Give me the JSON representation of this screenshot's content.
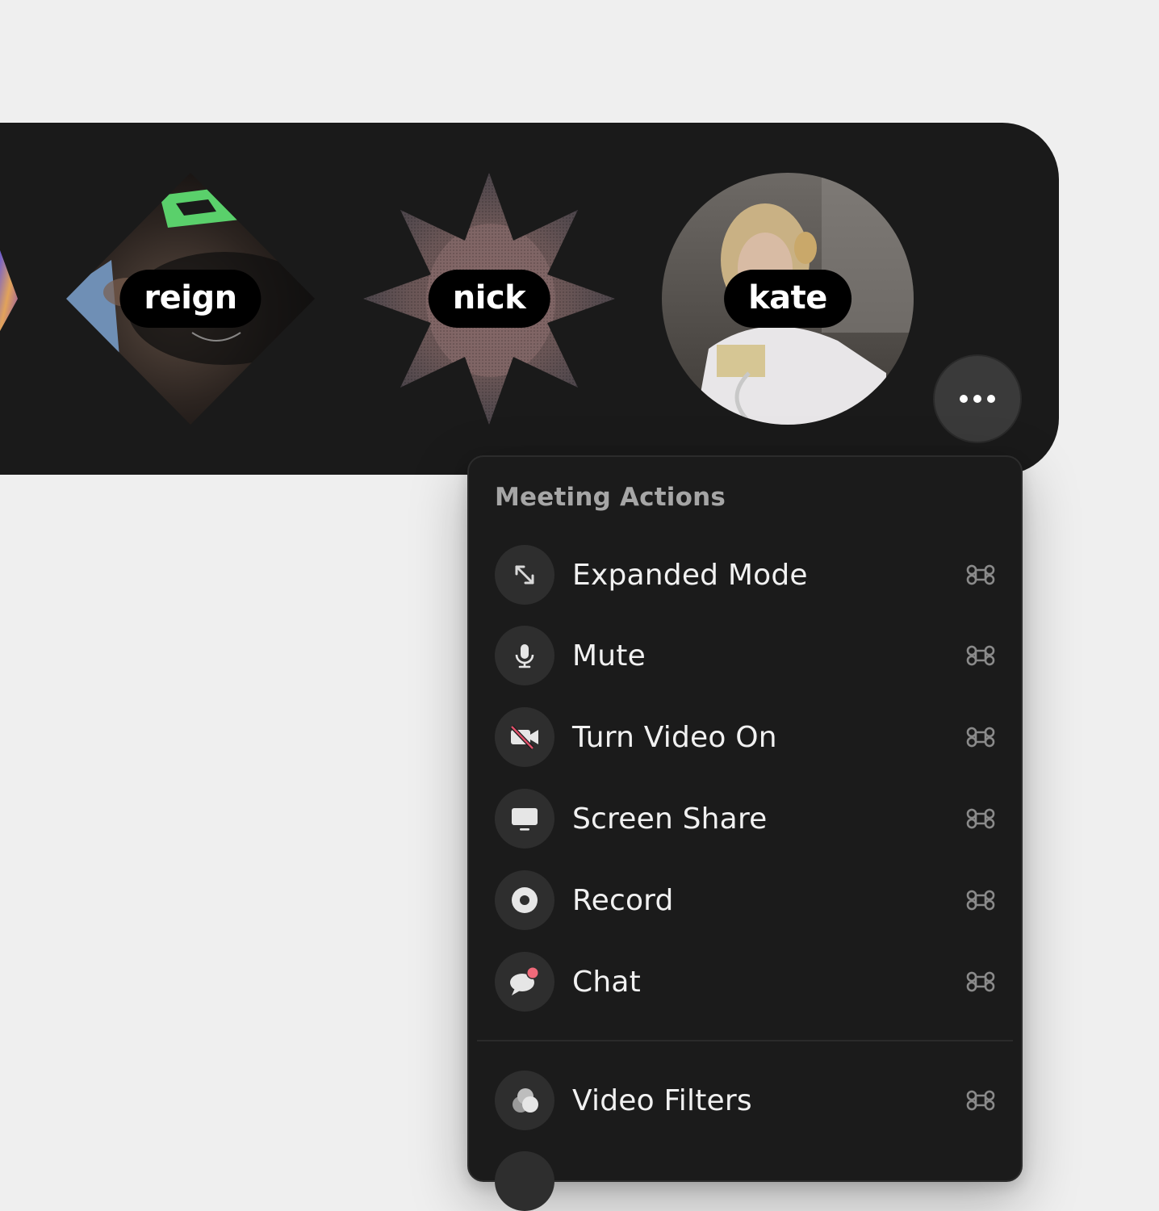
{
  "participants": [
    {
      "name": "reign",
      "shape": "diamond"
    },
    {
      "name": "nick",
      "shape": "star"
    },
    {
      "name": "kate",
      "shape": "circle"
    }
  ],
  "more_button": {
    "icon": "more-horizontal-icon"
  },
  "menu": {
    "title": "Meeting Actions",
    "items": [
      {
        "label": "Expanded Mode",
        "icon": "expand-icon",
        "shortcut": "⌘"
      },
      {
        "label": "Mute",
        "icon": "microphone-icon",
        "shortcut": "⌘"
      },
      {
        "label": "Turn Video On",
        "icon": "video-off-icon",
        "shortcut": "⌘"
      },
      {
        "label": "Screen Share",
        "icon": "monitor-icon",
        "shortcut": "⌘"
      },
      {
        "label": "Record",
        "icon": "record-icon",
        "shortcut": "⌘"
      },
      {
        "label": "Chat",
        "icon": "chat-icon",
        "shortcut": "⌘"
      },
      {
        "label": "Video Filters",
        "icon": "video-filters-icon",
        "shortcut": "⌘"
      }
    ]
  },
  "colors": {
    "bar_background": "#1a1a1a",
    "menu_background": "#1b1b1b",
    "notification_dot": "#f06a7a",
    "video_off_slash": "#e0506a"
  }
}
